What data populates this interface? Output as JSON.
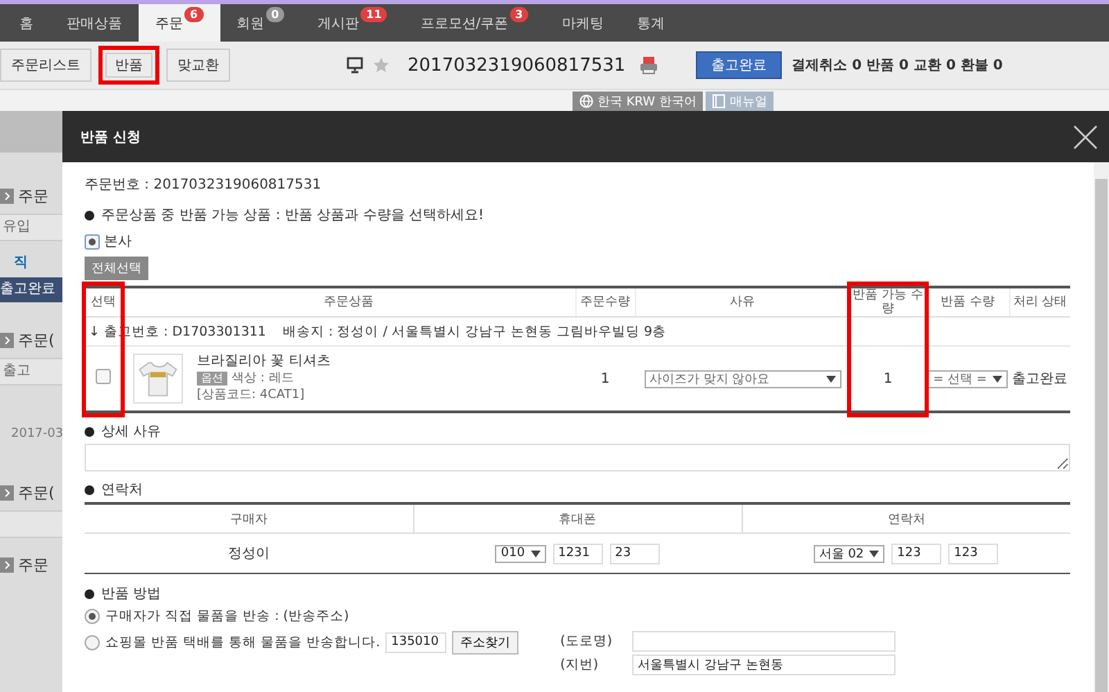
{
  "top_nav": {
    "tabs": [
      {
        "label": "홈",
        "selected": false
      },
      {
        "label": "판매상품",
        "selected": false
      },
      {
        "label": "주문",
        "selected": true,
        "badge": {
          "text": "6",
          "color": "#e04040"
        }
      },
      {
        "label": "회원",
        "selected": false,
        "badge": {
          "text": "0",
          "color": "#999999"
        }
      },
      {
        "label": "게시판",
        "selected": false,
        "badge": {
          "text": "11",
          "color": "#e04040"
        }
      },
      {
        "label": "프로모션/쿠폰",
        "selected": false,
        "badge": {
          "text": "3",
          "color": "#e04040"
        }
      },
      {
        "label": "마케팅",
        "selected": false
      },
      {
        "label": "통계",
        "selected": false
      }
    ]
  },
  "sub_nav": {
    "buttons": [
      {
        "label": "주문리스트",
        "highlighted": false
      },
      {
        "label": "반품",
        "highlighted": true
      },
      {
        "label": "맞교환",
        "highlighted": false
      }
    ],
    "order_number": "2017032319060817531",
    "status_badge": "출고완료",
    "summary": "결제취소 0 반품 0 교환 0 환불 0"
  },
  "locale_tabs": [
    {
      "label": "한국 KRW 한국어",
      "kind": "globe"
    },
    {
      "label": "매뉴얼",
      "kind": "book"
    }
  ],
  "background_page": [
    {
      "kind": "header"
    },
    {
      "kind": "section",
      "text": "주문"
    },
    {
      "kind": "cells",
      "text": "유입"
    },
    {
      "kind": "links",
      "text": "직"
    },
    {
      "kind": "band",
      "text": "출고완료"
    },
    {
      "kind": "section",
      "text": "주문("
    },
    {
      "kind": "cells",
      "text": "출고"
    },
    {
      "kind": "date",
      "text": "2017-03"
    },
    {
      "kind": "section",
      "text": "주문("
    },
    {
      "kind": "cells"
    },
    {
      "kind": "section",
      "text": "주문"
    }
  ],
  "modal": {
    "title": "반품 신청",
    "order_line": "주문번호 : 2017032319060817531",
    "notice": "주문상품 중 반품 가능 상품 : 반품 상품과 수량을 선택하세요!",
    "warehouse": {
      "label": "본사",
      "selected": true
    },
    "select_all": "전체선택",
    "items_table": {
      "columns": [
        {
          "label": "선택",
          "highlighted": true
        },
        {
          "label": "주문상품",
          "highlighted": false
        },
        {
          "label": "주문수량",
          "highlighted": false
        },
        {
          "label": "사유",
          "highlighted": false
        },
        {
          "label": "반품 가능 수량",
          "highlighted": true
        },
        {
          "label": "반품 수량",
          "highlighted": false
        },
        {
          "label": "처리 상태",
          "highlighted": false
        }
      ],
      "group": {
        "shipment": "↓ 출고번호 : D1703301311",
        "address": "배송지 : 정성이 / 서울특별시 강남구 논현동 그림바우빌딩 9층"
      },
      "rows": [
        {
          "checked": false,
          "name": "브라질리아 꽃 티셔츠",
          "option_tag": "옵션",
          "option": "색상 : 레드",
          "code": "[상품코드: 4CAT1]",
          "order_qty": "1",
          "reason": "사이즈가 맞지 않아요",
          "returnable_qty": "1",
          "return_qty": "= 선택 =",
          "status": "출고완료"
        }
      ]
    },
    "detail_reason": {
      "title": "상세 사유"
    },
    "contact": {
      "title": "연락처",
      "columns": [
        "구매자",
        "휴대폰",
        "연락처"
      ],
      "buyer": "정성이",
      "mobile": {
        "prefix": "010",
        "mid": "1231",
        "last": "23"
      },
      "phone": {
        "prefix": "서울 02",
        "mid": "123",
        "last": "123"
      }
    },
    "return_method": {
      "title": "반품 방법",
      "options": [
        {
          "label": "구매자가 직접 물품을 반송 : (반송주소)",
          "selected": true
        },
        {
          "label": "쇼핑몰 반품 택배를 통해 물품을 반송합니다.",
          "selected": false
        }
      ],
      "zip": "135010",
      "find_button": "주소찾기",
      "address_fields": [
        {
          "label": "(도로명)"
        },
        {
          "label": "(지번)",
          "value": "서울특별시 강남구 논현동"
        }
      ]
    }
  }
}
